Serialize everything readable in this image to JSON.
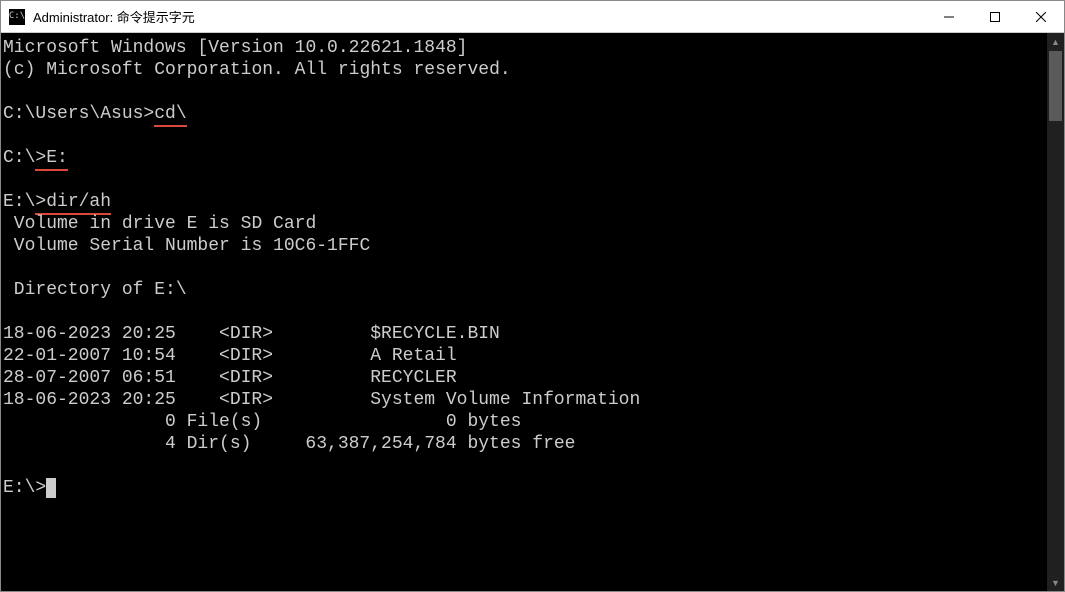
{
  "window": {
    "title": "Administrator: 命令提示字元",
    "icon_glyph": "C:\\"
  },
  "banner": {
    "line1": "Microsoft Windows [Version 10.0.22621.1848]",
    "line2": "(c) Microsoft Corporation. All rights reserved."
  },
  "prompts": [
    {
      "prefix": "C:\\Users\\Asus>",
      "cmd": "cd\\",
      "underline_cmd": true
    },
    {
      "prefix": "C:\\>",
      "cmd": "E:",
      "underline_cmd": true,
      "underline_caret": true
    },
    {
      "prefix": "E:\\>",
      "cmd": "dir/ah",
      "underline_cmd": true,
      "underline_caret": true
    }
  ],
  "dir_output": {
    "volume_line": " Volume in drive E is SD Card",
    "serial_line": " Volume Serial Number is 10C6-1FFC",
    "directory_of": " Directory of E:\\",
    "rows": [
      {
        "date": "18-06-2023",
        "time": "20:25",
        "type": "<DIR>",
        "name": "$RECYCLE.BIN"
      },
      {
        "date": "22-01-2007",
        "time": "10:54",
        "type": "<DIR>",
        "name": "A Retail"
      },
      {
        "date": "28-07-2007",
        "time": "06:51",
        "type": "<DIR>",
        "name": "RECYCLER"
      },
      {
        "date": "18-06-2023",
        "time": "20:25",
        "type": "<DIR>",
        "name": "System Volume Information"
      }
    ],
    "files_summary": {
      "count": "0 File(s)",
      "size": "0",
      "label": "bytes"
    },
    "dirs_summary": {
      "count": "4 Dir(s)",
      "size": "63,387,254,784",
      "label": "bytes free"
    }
  },
  "final_prompt": {
    "prefix": "E:\\>"
  }
}
